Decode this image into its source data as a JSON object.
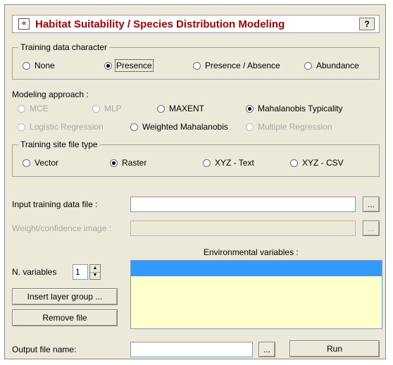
{
  "dialog": {
    "title": "Habitat Suitability / Species Distribution Modeling",
    "collapse_icon": "«",
    "help_label": "?"
  },
  "training_data_character": {
    "label": "Training data character",
    "options": [
      "None",
      "Presence",
      "Presence / Absence",
      "Abundance"
    ],
    "selected": "Presence"
  },
  "modeling_approach": {
    "label": "Modeling approach :",
    "options": [
      {
        "label": "MCE",
        "enabled": false
      },
      {
        "label": "MLP",
        "enabled": false
      },
      {
        "label": "MAXENT",
        "enabled": true
      },
      {
        "label": "Mahalanobis Typicality",
        "enabled": true
      },
      {
        "label": "Logistic Regression",
        "enabled": false
      },
      {
        "label": "Weighted Mahalanobis",
        "enabled": true
      },
      {
        "label": "Multiple Regression",
        "enabled": false
      }
    ],
    "selected": "Mahalanobis Typicality"
  },
  "training_site_file_type": {
    "label": "Training site file type",
    "options": [
      "Vector",
      "Raster",
      "XYZ - Text",
      "XYZ - CSV"
    ],
    "selected": "Raster"
  },
  "input_training_data_file": {
    "label": "Input training data file :",
    "value": "",
    "browse_label": "..."
  },
  "weight_confidence_image": {
    "label": "Weight/confidence image :",
    "value": "",
    "browse_label": "..."
  },
  "env_vars": {
    "label": "Environmental variables :"
  },
  "n_variables": {
    "label": "N. variables",
    "value": "1",
    "up": "▲",
    "down": "▼"
  },
  "buttons": {
    "insert_layer_group": "Insert layer group ...",
    "remove_file": "Remove file",
    "run": "Run"
  },
  "output_file": {
    "label": "Output file name:",
    "value": "",
    "browse_label": "..."
  }
}
